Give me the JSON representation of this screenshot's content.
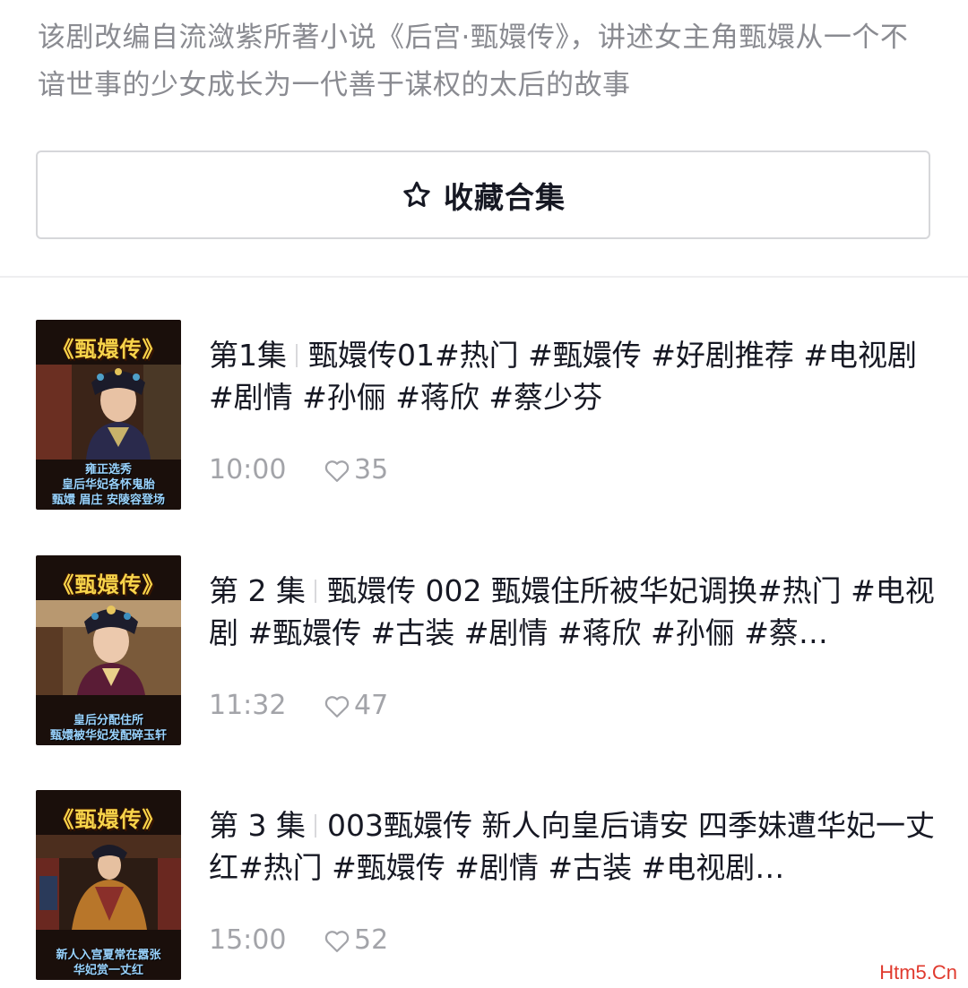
{
  "description": "该剧改编自流潋紫所著小说《后宫·甄嬛传》，讲述女主角甄嬛从一个不谙世事的少女成长为一代善于谋权的太后的故事",
  "collect_button": {
    "icon": "star-icon",
    "label": "收藏合集"
  },
  "episodes": [
    {
      "episode_label": "第1集",
      "title": "甄嬛传01#热门 #甄嬛传 #好剧推荐 #电视剧 #剧情 #孙俪 #蒋欣 #蔡少芬",
      "duration": "10:00",
      "likes": "35",
      "thumbnail": {
        "banner": "《甄嬛传》",
        "caption": [
          "雍正选秀",
          "皇后华妃各怀鬼胎",
          "甄嬛 眉庄 安陵容登场"
        ]
      }
    },
    {
      "episode_label": "第 2 集",
      "title": "甄嬛传 002 甄嬛住所被华妃调换#热门 #电视剧 #甄嬛传 #古装 #剧情 #蒋欣 #孙俪 #蔡…",
      "duration": "11:32",
      "likes": "47",
      "thumbnail": {
        "banner": "《甄嬛传》",
        "caption": [
          "皇后分配住所",
          "甄嬛被华妃发配碎玉轩"
        ]
      }
    },
    {
      "episode_label": "第 3 集",
      "title": "003甄嬛传 新人向皇后请安 四季妹遭华妃一丈红#热门 #甄嬛传 #剧情 #古装 #电视剧…",
      "duration": "15:00",
      "likes": "52",
      "thumbnail": {
        "banner": "《甄嬛传》",
        "caption": [
          "新人入宫夏常在嚣张",
          "华妃赏一丈红"
        ]
      }
    }
  ],
  "watermark": "Htm5.Cn",
  "colors": {
    "text_primary": "#161823",
    "text_secondary": "#8a8b91",
    "meta": "#a3a4a9",
    "border": "#d6d7da"
  }
}
